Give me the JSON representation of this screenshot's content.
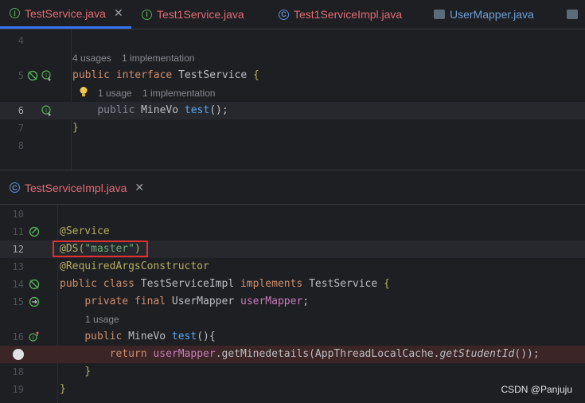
{
  "top_tabs": [
    {
      "label": "TestService.java",
      "icon": "interface-icon",
      "active": true
    },
    {
      "label": "Test1Service.java",
      "icon": "interface-icon",
      "active": false
    },
    {
      "label": "Test1ServiceImpl.java",
      "icon": "class-icon",
      "active": false
    },
    {
      "label": "UserMapper.java",
      "icon": "mapper-icon",
      "active": false
    }
  ],
  "top_editor": {
    "line_numbers": [
      "4",
      "5",
      "6",
      "7",
      "8"
    ],
    "hint_interface": "4 usages    1 implementation",
    "hint_method": "1 usage    1 implementation",
    "code": {
      "l5_kw1": "public",
      "l5_kw2": "interface",
      "l5_name": "TestService",
      "l5_brace": "{",
      "l6_kw": "public",
      "l6_type": "MineVo",
      "l6_method": "test",
      "l6_rest": "();",
      "l7": "}"
    }
  },
  "bottom_tab": {
    "label": "TestServiceImpl.java",
    "icon": "class-icon"
  },
  "bottom_editor": {
    "line_numbers": [
      "10",
      "11",
      "12",
      "13",
      "14",
      "15",
      "16",
      "18",
      "19"
    ],
    "hint_usage": "1 usage",
    "code": {
      "l11": "@Service",
      "l12_ann": "@DS(",
      "l12_str": "\"master\"",
      "l12_end": ")",
      "l13": "@RequiredArgsConstructor",
      "l14_kw": "public class",
      "l14_name": "TestServiceImpl",
      "l14_kw2": "implements",
      "l14_iface": "TestService",
      "l14_brace": "{",
      "l15_kw": "private final",
      "l15_type": "UserMapper",
      "l15_field": "userMapper",
      "l15_end": ";",
      "l16_kw": "public",
      "l16_type": "MineVo",
      "l16_method": "test",
      "l16_rest": "(){",
      "l17_kw": "return",
      "l17_field": "userMapper",
      "l17_call": ".getMinedetails(AppThreadLocalCache.",
      "l17_static": "getStudentId",
      "l17_end": "());",
      "l18": "}",
      "l19": "}"
    }
  },
  "watermark": "CSDN @Panjuju",
  "colors": {
    "background": "#1e1f22",
    "keyword": "#cf8e6d",
    "annotation": "#b3ae60",
    "string": "#6aab73",
    "field": "#c77dbb",
    "method": "#56a8f5",
    "highlight_box": "#e0302f",
    "breakpoint_line": "#3b2526",
    "accent": "#3574f0"
  }
}
